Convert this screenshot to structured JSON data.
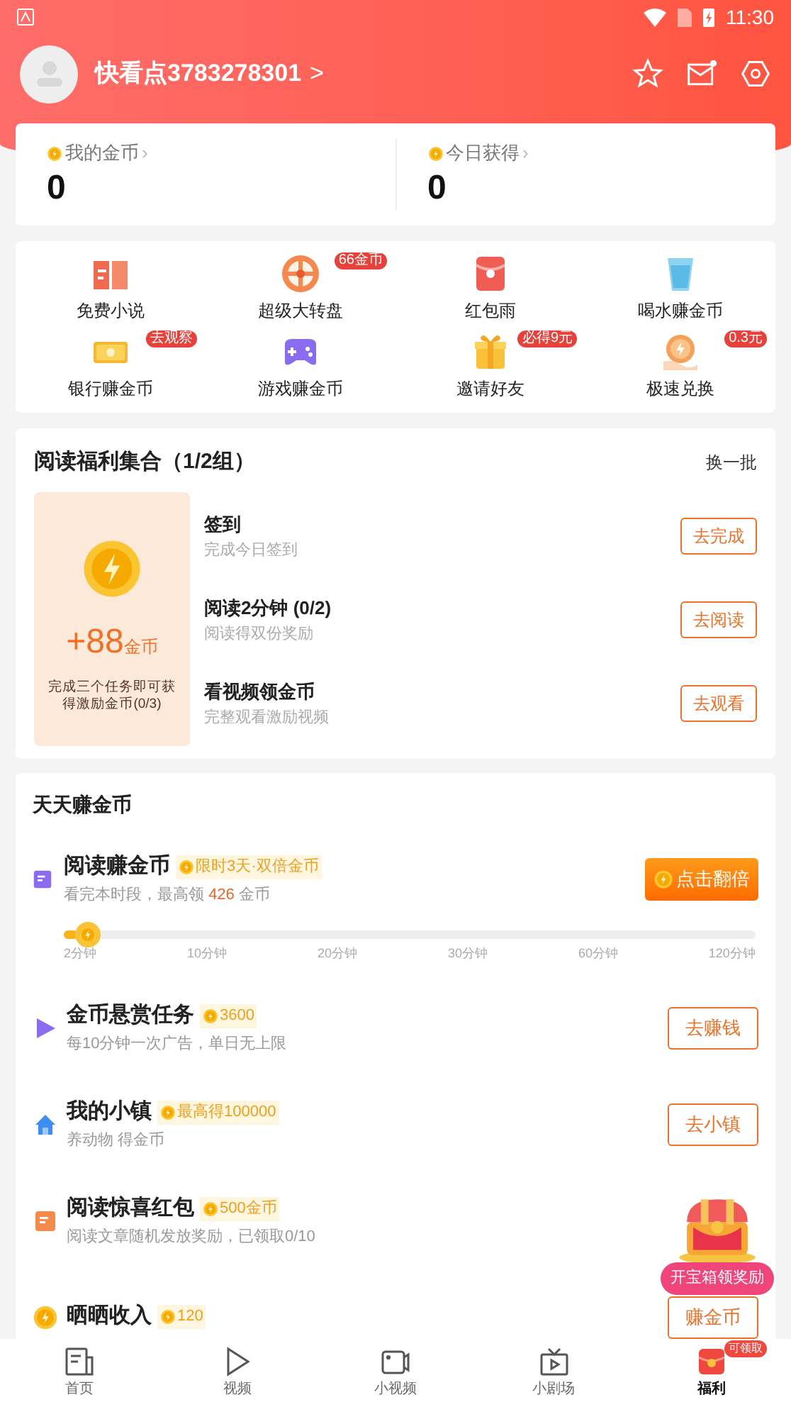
{
  "status_bar": {
    "time": "11:30"
  },
  "profile": {
    "name": "快看点3783278301",
    "arrow": ">"
  },
  "stats": [
    {
      "label": "我的金币",
      "arrow": "›",
      "value": "0"
    },
    {
      "label": "今日获得",
      "arrow": "›",
      "value": "0"
    }
  ],
  "shortcuts": [
    {
      "label": "免费小说",
      "kind": "book"
    },
    {
      "label": "超级大转盘",
      "kind": "wheel",
      "badge": "66金币"
    },
    {
      "label": "红包雨",
      "kind": "envelope"
    },
    {
      "label": "喝水赚金币",
      "kind": "cup"
    },
    {
      "label": "银行赚金币",
      "kind": "bank",
      "badge": "去观察"
    },
    {
      "label": "游戏赚金币",
      "kind": "game"
    },
    {
      "label": "邀请好友",
      "kind": "gift",
      "badge": "必得9元"
    },
    {
      "label": "极速兑换",
      "kind": "coin",
      "badge": "0.3元"
    }
  ],
  "reading_bonus": {
    "title": "阅读福利集合（1/2组）",
    "refresh": "换一批",
    "reward": "+88",
    "reward_unit": "金币",
    "reward_note": "完成三个任务即可获得激励金币(0/3)",
    "tasks": [
      {
        "title": "签到",
        "subtitle": "完成今日签到",
        "button": "去完成"
      },
      {
        "title": "阅读2分钟 (0/2)",
        "subtitle": "阅读得双份奖励",
        "button": "去阅读"
      },
      {
        "title": "看视频领金币",
        "subtitle": "完整观看激励视频",
        "button": "去观看"
      }
    ]
  },
  "daily": {
    "title": "天天赚金币",
    "read_task": {
      "title": "阅读赚金币",
      "tag": "限时3天·双倍金币",
      "subtitle_before": "看完本时段，最高领",
      "highlight": "426",
      "subtitle_after": "金币",
      "button": "点击翻倍",
      "level": 0.02,
      "milestones": [
        "2分钟",
        "10分钟",
        "20分钟",
        "30分钟",
        "60分钟",
        "120分钟"
      ]
    },
    "tasks": [
      {
        "kind": "play",
        "title": "金币悬赏任务",
        "tag": "3600",
        "subtitle": "每10分钟一次广告，单日无上限",
        "button": "去赚钱"
      },
      {
        "kind": "house",
        "title": "我的小镇",
        "tag": "最高得100000",
        "subtitle": "养动物 得金币",
        "button": "去小镇"
      },
      {
        "kind": "note",
        "title": "阅读惊喜红包",
        "tag": "500金币",
        "subtitle": "阅读文章随机发放奖励，已领取0/10"
      },
      {
        "kind": "coin",
        "title": "晒晒收入",
        "tag": "120",
        "button": "赚金币"
      }
    ]
  },
  "floating_chest": {
    "label": "开宝箱领奖励"
  },
  "bottom_nav": [
    {
      "label": "首页",
      "kind": "home",
      "selected": false
    },
    {
      "label": "视频",
      "kind": "video",
      "selected": false
    },
    {
      "label": "小视频",
      "kind": "short",
      "selected": false
    },
    {
      "label": "小剧场",
      "kind": "theater",
      "selected": false
    },
    {
      "label": "福利",
      "kind": "welfare",
      "selected": true,
      "badge": "可领取"
    }
  ]
}
